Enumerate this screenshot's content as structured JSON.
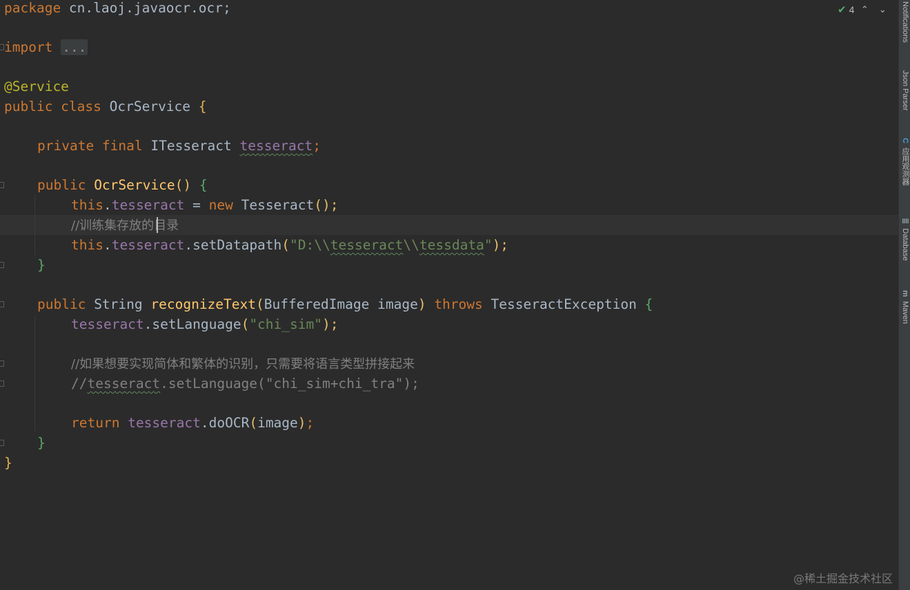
{
  "editor": {
    "package_kw": "package",
    "package_name": " cn.laoj.javaocr.ocr;",
    "import_kw": "import",
    "import_fold": "...",
    "annotation": "@Service",
    "class_decl_kw": "public class",
    "class_name": " OcrService ",
    "brace_open": "{",
    "brace_close": "}",
    "field_mods": "private final",
    "field_type": " ITesseract ",
    "field_name": "tesseract",
    "semicolon": ";",
    "ctor_kw": "public",
    "ctor_name": " OcrService",
    "parens_empty": "()",
    "this_kw": "this",
    "dot": ".",
    "assign": " = ",
    "new_kw": "new",
    "new_type": " Tesseract",
    "paren_semi": "();",
    "comment_train": "//训练集存放的目录",
    "method_setDatapath": "setDatapath",
    "paren_open": "(",
    "paren_close_semi": ");",
    "str_datapath_prefix": "\"D:\\\\",
    "str_datapath_part1": "tesseract",
    "str_datapath_sep": "\\\\",
    "str_datapath_part2": "tessdata",
    "str_datapath_suffix": "\"",
    "method_kw": "public",
    "return_type": " String ",
    "method_name": "recognizeText",
    "param_type": "BufferedImage",
    "param_name": " image",
    "paren_close": ")",
    "throws_kw": " throws ",
    "exception_type": "TesseractException ",
    "method_setLanguage": "setLanguage",
    "str_lang": "\"chi_sim\"",
    "comment_combine": "//如果想要实现简体和繁体的识别，只需要将语言类型拼接起来",
    "comment_code_prefix": "//",
    "comment_code_ident": "tesseract",
    "comment_code_rest": ".setLanguage(\"chi_sim+chi_tra\");",
    "return_kw": "return",
    "method_doOCR": "doOCR",
    "arg_image": "image"
  },
  "inspection": {
    "count": "4",
    "up": "⌃",
    "down": "⌄"
  },
  "tool_windows": [
    {
      "label": "Notifications",
      "icon": ""
    },
    {
      "label": "Json Parser",
      "icon": ""
    },
    {
      "label": "应用观测器",
      "icon": "C"
    },
    {
      "label": "Database",
      "icon": "≣"
    },
    {
      "label": "Maven",
      "icon": "m"
    }
  ],
  "watermark": "@稀土掘金技术社区",
  "colors": {
    "background": "#2b2b2b",
    "keyword": "#cc7832",
    "annotation": "#bbb529",
    "field": "#9876aa",
    "method": "#ffc66d",
    "string": "#6a8759",
    "comment": "#808080",
    "text": "#a9b7c6"
  }
}
